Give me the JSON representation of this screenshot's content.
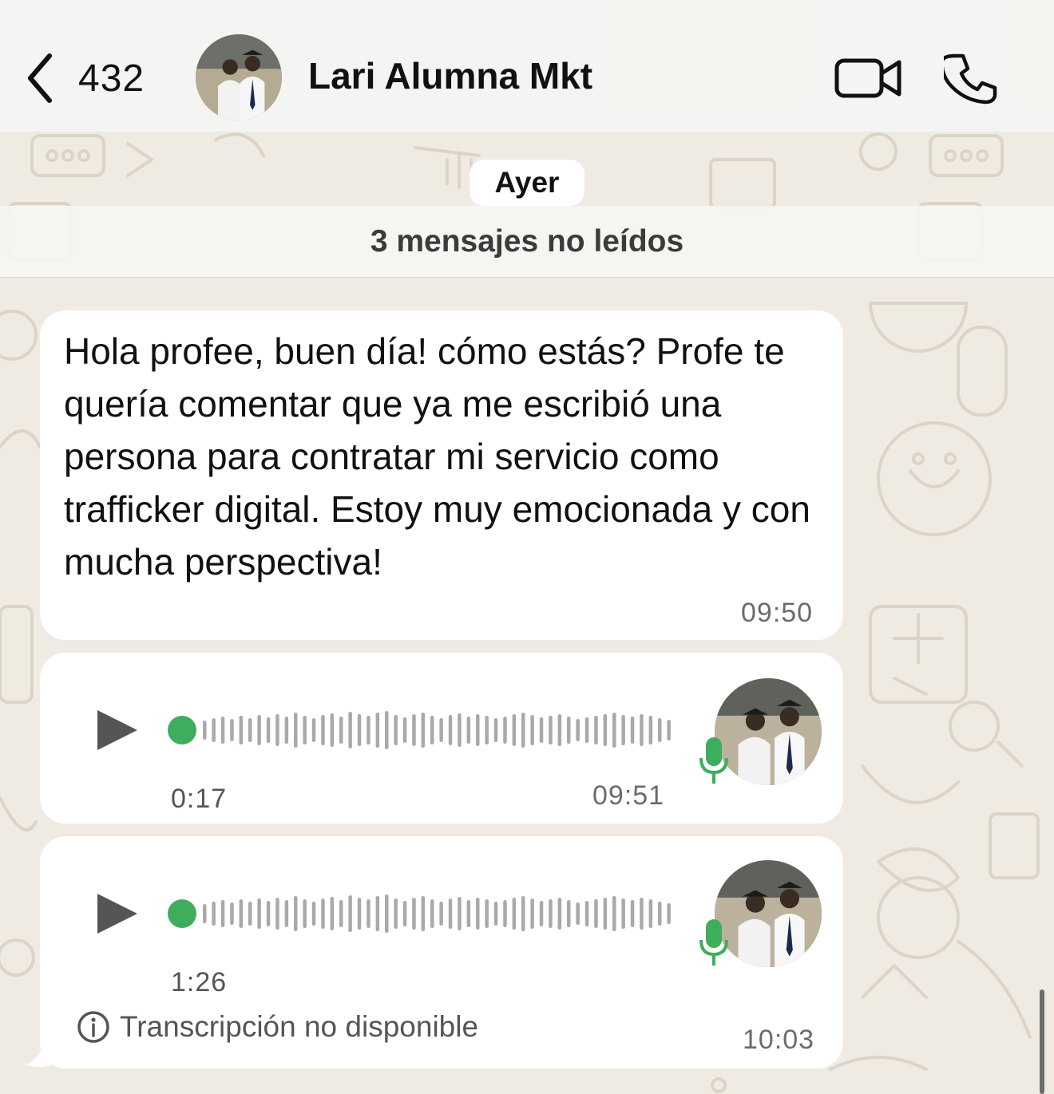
{
  "colors": {
    "background": "#efeae2",
    "bubble": "#ffffff",
    "accent_green": "#3eae5c",
    "waveform_gray": "#a9a9a9"
  },
  "header": {
    "back_count": "432",
    "contact_name": "Lari Alumna Mkt",
    "icons": [
      "chevron-left-icon",
      "video-camera-icon",
      "phone-icon"
    ]
  },
  "chat": {
    "date_label": "Ayer",
    "unread_label": "3 mensajes no leídos",
    "messages": [
      {
        "type": "text",
        "text": "Hola profee, buen día! cómo estás? Profe te quería comentar que ya me escribió una persona para contratar mi servicio como trafficker digital. Estoy muy emocionada y con mucha perspectiva!",
        "time": "09:50"
      },
      {
        "type": "audio",
        "duration": "0:17",
        "time": "09:51",
        "progress": 0
      },
      {
        "type": "audio",
        "duration": "1:26",
        "time": "10:03",
        "progress": 0,
        "transcription_note": "Transcripción no disponible"
      }
    ]
  }
}
